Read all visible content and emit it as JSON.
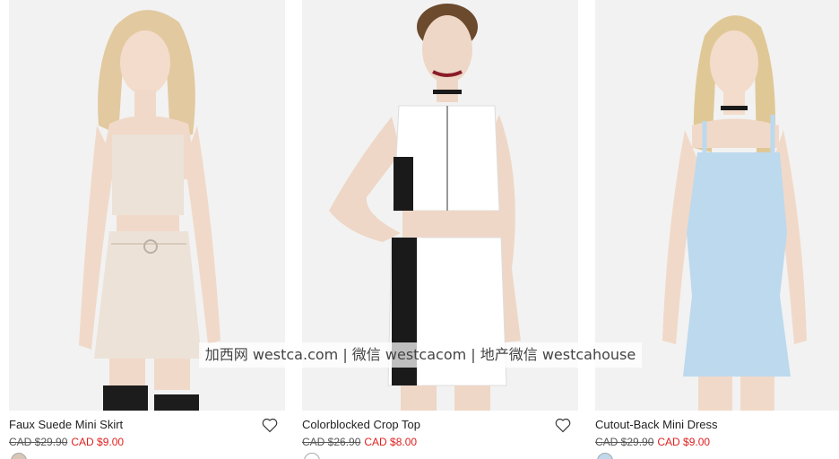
{
  "products": [
    {
      "name": "Faux Suede Mini Skirt",
      "old_price": "CAD $29.90",
      "sale_price": "CAD $9.00",
      "swatch_color": "#d9c7b6",
      "outfit_color": "#ece2d8",
      "hair_color": "#e2c9a0",
      "heart_icon": "heart-outline-icon"
    },
    {
      "name": "Colorblocked Crop Top",
      "old_price": "CAD $26.90",
      "sale_price": "CAD $8.00",
      "swatch_color": "#ffffff",
      "outfit_color": "#ffffff",
      "hair_color": "#6b4a2e",
      "heart_icon": "heart-outline-icon"
    },
    {
      "name": "Cutout-Back Mini Dress",
      "old_price": "CAD $29.90",
      "sale_price": "CAD $9.00",
      "swatch_color": "#bfd8ec",
      "outfit_color": "#bcd9ee",
      "hair_color": "#e0c896"
    }
  ],
  "watermark": "加西网 westca.com | 微信 westcacom | 地产微信 westcahouse",
  "colors": {
    "sale": "#e02020",
    "text": "#222222",
    "skin": "#f1d9c9",
    "photo_bg": "#f3f3f3"
  }
}
